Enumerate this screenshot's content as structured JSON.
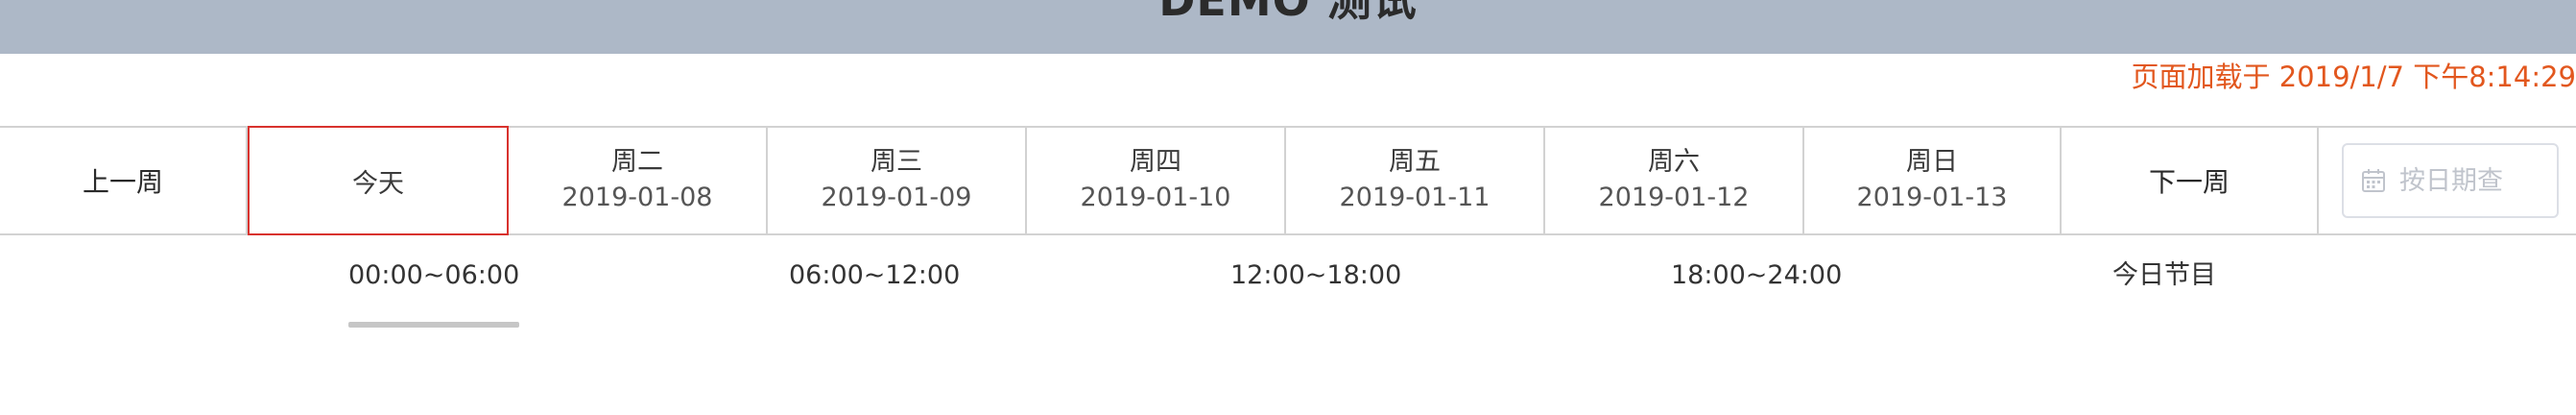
{
  "header": {
    "title": "DEMO 测试"
  },
  "status": {
    "load_time": "页面加载于 2019/1/7 下午8:14:29"
  },
  "week_nav": {
    "prev_week": "上一周",
    "today": "今天",
    "days": [
      {
        "name": "周二",
        "date": "2019-01-08"
      },
      {
        "name": "周三",
        "date": "2019-01-09"
      },
      {
        "name": "周四",
        "date": "2019-01-10"
      },
      {
        "name": "周五",
        "date": "2019-01-11"
      },
      {
        "name": "周六",
        "date": "2019-01-12"
      },
      {
        "name": "周日",
        "date": "2019-01-13"
      }
    ],
    "next_week": "下一周",
    "date_picker": {
      "placeholder": "按日期查",
      "icon": "calendar-icon"
    }
  },
  "time_slots": {
    "items": [
      "00:00~06:00",
      "06:00~12:00",
      "12:00~18:00",
      "18:00~24:00",
      "今日节目"
    ],
    "selected": "00:00~06:00"
  },
  "colors": {
    "header_bg": "#adb8c7",
    "accent_red": "#d8322e",
    "load_time": "#e2571e",
    "border": "#d2d2d2"
  }
}
